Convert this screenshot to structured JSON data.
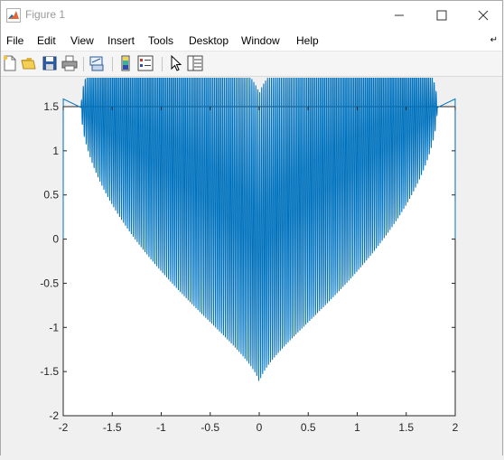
{
  "window": {
    "title": "Figure 1",
    "controls": {
      "minimize": "minimize",
      "maximize": "maximize",
      "close": "close"
    }
  },
  "menu": {
    "items": [
      {
        "label": "File"
      },
      {
        "label": "Edit"
      },
      {
        "label": "View"
      },
      {
        "label": "Insert"
      },
      {
        "label": "Tools"
      },
      {
        "label": "Desktop"
      },
      {
        "label": "Window"
      },
      {
        "label": "Help"
      }
    ],
    "dock_icon": "dock-arrow-icon"
  },
  "toolbar": {
    "buttons": [
      {
        "icon": "new-figure-icon"
      },
      {
        "icon": "open-file-icon"
      },
      {
        "icon": "save-figure-icon"
      },
      {
        "icon": "print-figure-icon"
      },
      {
        "icon": "link-plot-icon"
      },
      {
        "icon": "insert-colorbar-icon"
      },
      {
        "icon": "insert-legend-icon"
      },
      {
        "icon": "edit-plot-icon"
      },
      {
        "icon": "property-inspector-icon"
      }
    ]
  },
  "colors": {
    "line": "#0072bd",
    "axes_bg": "#ffffff",
    "figure_bg": "#f0f0f0"
  },
  "chart_data": {
    "type": "line",
    "function": "y = |x|^(2/3) + 0.9*sqrt(3.3 - x^2)*sin(100*pi*x)",
    "x_range": [
      -2,
      2
    ],
    "xlim": [
      -2,
      2
    ],
    "ylim": [
      -2,
      1.5
    ],
    "x_ticks": [
      -2,
      -1.5,
      -1,
      -0.5,
      0,
      0.5,
      1,
      1.5,
      2
    ],
    "y_ticks": [
      -2,
      -1.5,
      -1,
      -0.5,
      0,
      0.5,
      1,
      1.5
    ],
    "x_tick_labels": [
      "-2",
      "-1.5",
      "-1",
      "-0.5",
      "0",
      "0.5",
      "1",
      "1.5",
      "2"
    ],
    "y_tick_labels": [
      "-2",
      "-1.5",
      "-1",
      "-0.5",
      "0",
      "0.5",
      "1",
      "1.5"
    ],
    "title": "",
    "xlabel": "",
    "ylabel": "",
    "grid": false,
    "legend": "none"
  }
}
